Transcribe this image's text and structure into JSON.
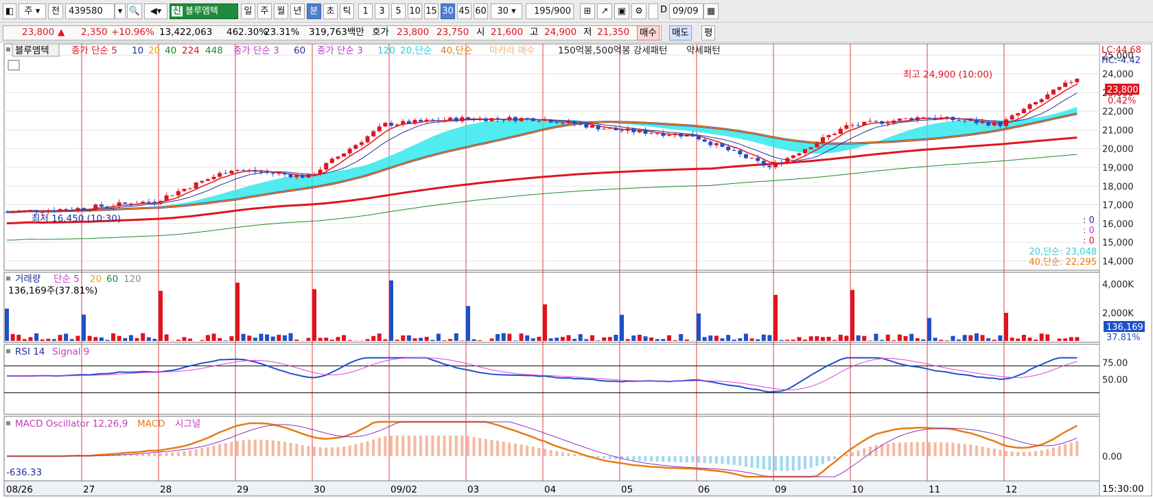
{
  "toolbar": {
    "stock_type": "주",
    "prev_label": "전",
    "stock_code": "439580",
    "badge": "신",
    "stock_name": "블루엠텍",
    "period_buttons": [
      "일",
      "주",
      "월",
      "년",
      "분",
      "초",
      "틱"
    ],
    "interval_buttons": [
      "1",
      "3",
      "5",
      "10",
      "15",
      "30",
      "45",
      "60"
    ],
    "interval_select": "30",
    "count": "195",
    "count_total": "/900",
    "date": "09/09",
    "checkbox_label": "D"
  },
  "quote": {
    "price": "23,800",
    "arrow": "▲",
    "change": "2,350",
    "change_pct": "+10.96%",
    "volume": "13,422,063",
    "volume_ratio": "462.30%",
    "turnover": "23.31%",
    "amount": "319,763백만",
    "hoga_label": "호가",
    "ask": "23,800",
    "bid": "23,750",
    "open_label": "시",
    "open": "21,600",
    "high_label": "고",
    "high": "24,900",
    "low_label": "저",
    "low": "21,350",
    "buy_label": "매수",
    "sell_label": "매도",
    "eval_label": "평"
  },
  "legends": {
    "price_name": "블루엠텍",
    "ma_close": "종가 단순 5",
    "ma_close_periods": [
      "10",
      "20",
      "40",
      "224",
      "448"
    ],
    "ma3_a": "종가 단순 3",
    "ma3_a_period": "60",
    "ma3_b": "종가 단순 3",
    "ma3_b_period": "120",
    "ma20": "20,단순",
    "ma40": "40,단순",
    "makara": "마카라 매수",
    "pattern": "150억봉,500억봉 강세패턴",
    "pattern2": "약세패턴",
    "volume": "거래량",
    "volume_ma": "단순 5",
    "volume_periods": [
      "20",
      "60",
      "120"
    ],
    "volume_now": "136,169주(37.81%)",
    "rsi": "RSI 14",
    "rsi_signal": "Signal 9",
    "macd": "MACD Oscillator 12,26,9",
    "macd_line": "MACD",
    "macd_signal": "시그널"
  },
  "annotations": {
    "high_mark": "최고 24,900 (10:00)",
    "low_mark": "최저 16,450 (10:30)",
    "lc": "LC:44.68",
    "hc": "HC:-4.42",
    "price_tag": "23,800",
    "pct_tag": "0.42%",
    "ma20_value": "20,단순: 23,048",
    "ma40_value": "40,단순: 22,295",
    "zero_labels": [
      ": 0",
      ": 0",
      ": 0"
    ],
    "vol_tag": "136,169",
    "vol_pct_tag": "37.81%",
    "macd_value": "-636.33",
    "time": "15:30:00"
  },
  "chart_data": {
    "type": "candlestick",
    "title": "블루엠텍 (439580) 30분",
    "x_dates": [
      "08/26",
      "27",
      "28",
      "29",
      "30",
      "09/02",
      "03",
      "04",
      "05",
      "06",
      "09",
      "10",
      "11",
      "12"
    ],
    "price_axis": {
      "ticks": [
        14000,
        15000,
        16000,
        17000,
        18000,
        19000,
        20000,
        21000,
        22000,
        23000,
        24000,
        25000
      ],
      "tick_labels": [
        "14,000",
        "15,000",
        "16,000",
        "17,000",
        "18,000",
        "19,000",
        "20,000",
        "21,000",
        "22,000",
        "23,000",
        "24,000",
        "25,000"
      ],
      "range": [
        13500,
        25600
      ]
    },
    "daily_close": [
      16800,
      17200,
      18900,
      18500,
      21300,
      21600,
      21600,
      21000,
      20700,
      19000,
      21200,
      21700,
      21300,
      23800
    ],
    "series": [
      {
        "name": "20,단순",
        "last": 23048
      },
      {
        "name": "40,단순",
        "last": 22295
      }
    ],
    "volume_axis": {
      "ticks": [
        2000,
        4000
      ],
      "tick_labels": [
        "2,000K",
        "4,000K"
      ]
    },
    "rsi_axis": {
      "ticks": [
        50,
        75
      ],
      "tick_labels": [
        "50.00",
        "75.00"
      ]
    },
    "macd_axis": {
      "ticks": [
        0
      ],
      "tick_labels": [
        "0.00"
      ]
    },
    "high": 24900,
    "low": 16450,
    "last": 23800,
    "grid": true
  }
}
